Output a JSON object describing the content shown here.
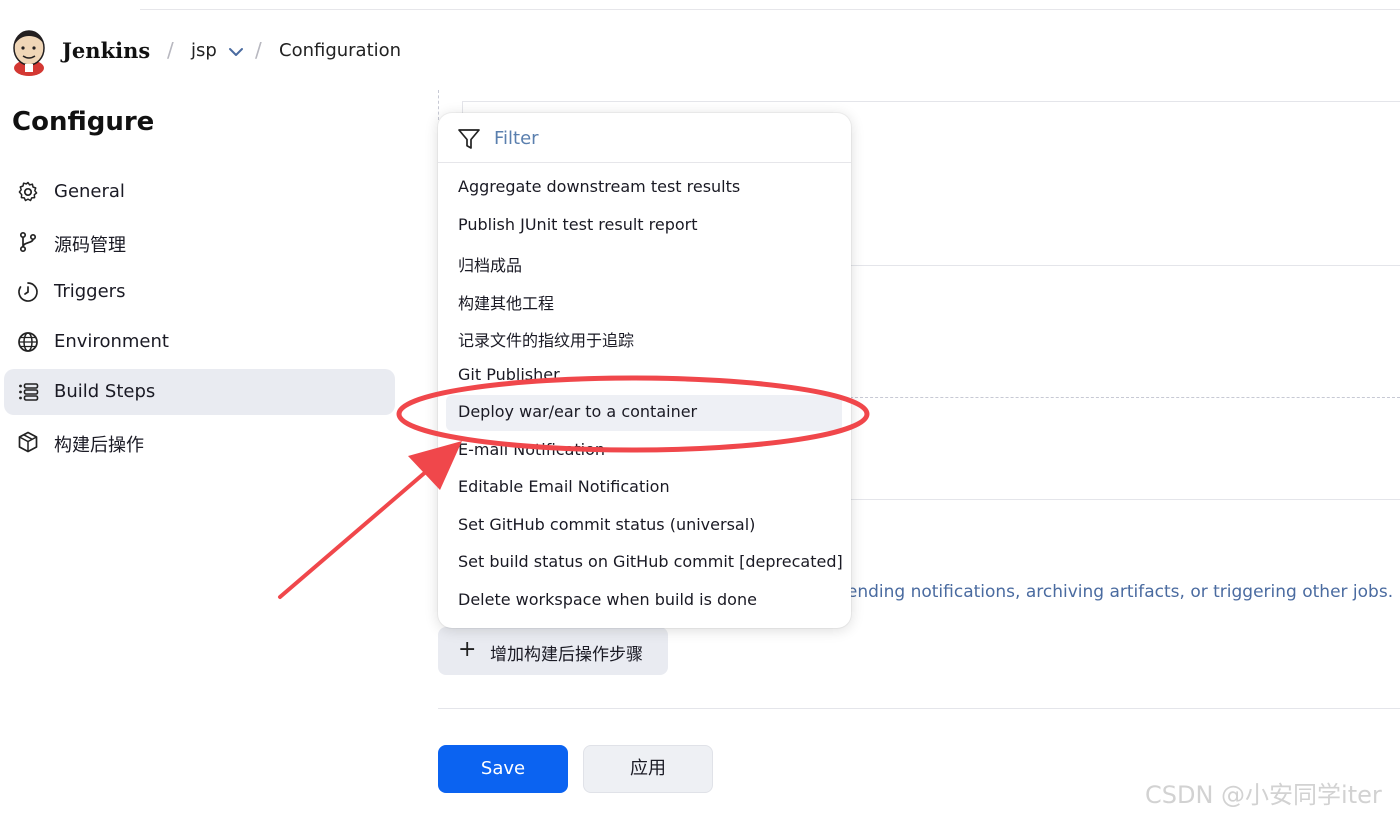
{
  "header": {
    "brand": "Jenkins",
    "project": "jsp",
    "page": "Configuration",
    "separator": "/"
  },
  "sidebar": {
    "title": "Configure",
    "items": [
      {
        "label": "General",
        "icon": "gear-icon"
      },
      {
        "label": "源码管理",
        "icon": "branch-icon"
      },
      {
        "label": "Triggers",
        "icon": "timer-icon"
      },
      {
        "label": "Environment",
        "icon": "globe-icon"
      },
      {
        "label": "Build Steps",
        "icon": "list-icon",
        "active": true
      },
      {
        "label": "构建后操作",
        "icon": "package-icon"
      }
    ]
  },
  "dropdown": {
    "filter_placeholder": "Filter",
    "options": [
      "Aggregate downstream test results",
      "Publish JUnit test result report",
      "归档成品",
      "构建其他工程",
      "记录文件的指纹用于追踪",
      "Git Publisher",
      "Deploy war/ear to a container",
      "E-mail Notification",
      "Editable Email Notification",
      "Set GitHub commit status (universal)",
      "Set build status on GitHub commit [deprecated]",
      "Delete workspace when build is done"
    ],
    "highlighted_option": "Deploy war/ear to a container"
  },
  "main": {
    "help_text": "sending notifications, archiving artifacts, or triggering other jobs.",
    "add_step_label": "增加构建后操作步骤"
  },
  "footer": {
    "save_label": "Save",
    "apply_label": "应用"
  },
  "annotation": {
    "color": "#f0474b",
    "shape": "ellipse-and-arrow"
  },
  "watermark": "CSDN @小安同学iter",
  "colors": {
    "primary": "#0b63f1",
    "active_bg": "#e9ebf1",
    "link_text": "#4a6ba0"
  }
}
